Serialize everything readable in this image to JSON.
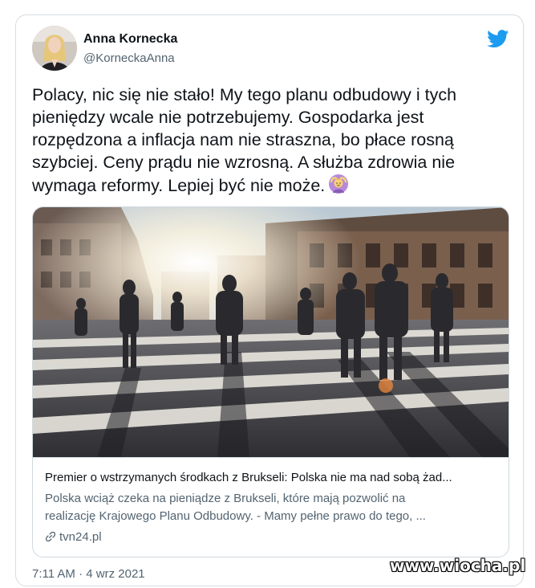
{
  "author": {
    "name": "Anna Kornecka",
    "handle": "@KorneckaAnna"
  },
  "icons": {
    "logo": "twitter-bird-icon",
    "avatar": "avatar-photo",
    "emoji": "person-gesturing-ok-emoji",
    "link": "link-icon"
  },
  "tweet": {
    "text": "Polacy, nic się nie stało! My tego planu odbudowy i tych\npieniędzy wcale nie potrzebujemy. Gospodarka jest\nrozpędzona a inflacja nam nie straszna, bo płace rosną\nszybciej. Ceny prądu nie wzrosną. A służba zdrowia nie\nwymaga reformy. Lepiej być nie może.",
    "timestamp": "7:11 AM · 4 wrz 2021"
  },
  "link_card": {
    "title": "Premier o wstrzymanych środkach z Brukseli: Polska nie ma nad sobą żad...",
    "description": "Polska wciąż czeka na pieniądze z Brukseli, które mają pozwolić na\nrealizację Krajowego Planu Odbudowy. - Mamy pełne prawo do tego, ...",
    "domain": "tvn24.pl"
  },
  "watermark": "www.wiocha.pl",
  "colors": {
    "twitter_blue": "#1d9bf0",
    "text_primary": "#0f1419",
    "text_secondary": "#536471",
    "border": "#cfd9de"
  }
}
